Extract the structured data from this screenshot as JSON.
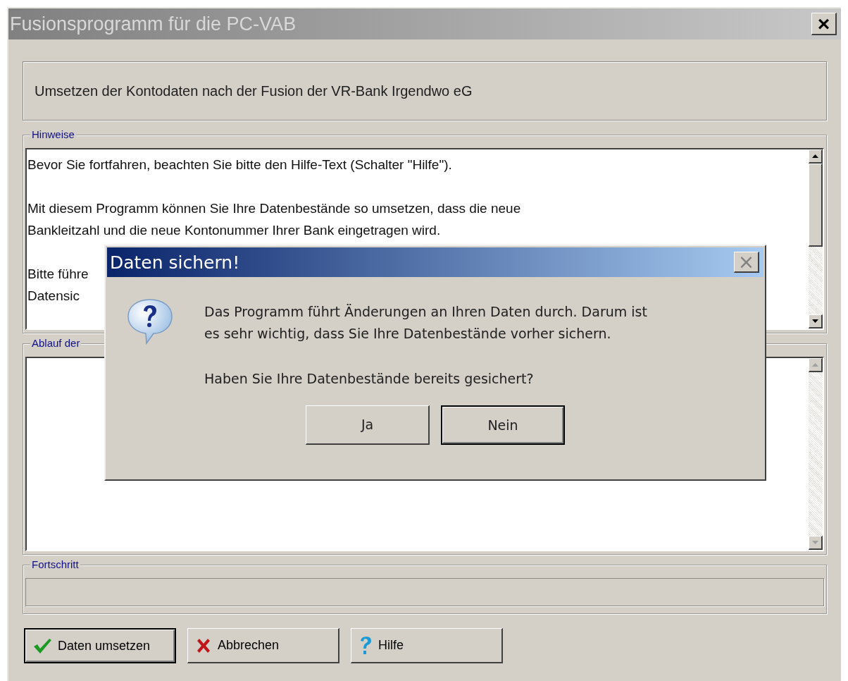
{
  "window": {
    "title": "Fusionsprogramm für die PC-VAB",
    "close": "×"
  },
  "header": "Umsetzen der Kontodaten nach der Fusion der VR-Bank Irgendwo eG",
  "notes": {
    "label": "Hinweise",
    "paragraphs": [
      [
        "Bevor Sie fortfahren, beachten Sie bitte den Hilfe-Text (Schalter \"Hilfe\")."
      ],
      [
        "Mit diesem Programm können Sie Ihre Datenbestände so umsetzen, dass die neue",
        "Bankleitzahl und die neue Kontonummer Ihrer Bank eingetragen wird."
      ],
      [
        "Bitte führe",
        "Datensic"
      ]
    ]
  },
  "log": {
    "label": "Ablauf der"
  },
  "progress": {
    "label": "Fortschritt",
    "level": 0
  },
  "buttons": [
    {
      "kind": "check",
      "label": "Daten umsetzen",
      "default": true
    },
    {
      "kind": "cancel",
      "label": "Abbrechen",
      "default": false
    },
    {
      "kind": "help",
      "label": "Hilfe",
      "default": false
    }
  ],
  "dialog": {
    "title": "Daten sichern!",
    "close": "×",
    "message": [
      "Das Programm führt Änderungen an Ihren Daten durch. Darum ist",
      "es sehr wichtig, dass Sie Ihre Datenbestände vorher sichern."
    ],
    "question": "Haben Sie Ihre Datenbestände bereits gesichert?",
    "buttons": [
      {
        "label": "Ja",
        "focused": false
      },
      {
        "label": "Nein",
        "focused": true
      }
    ]
  }
}
